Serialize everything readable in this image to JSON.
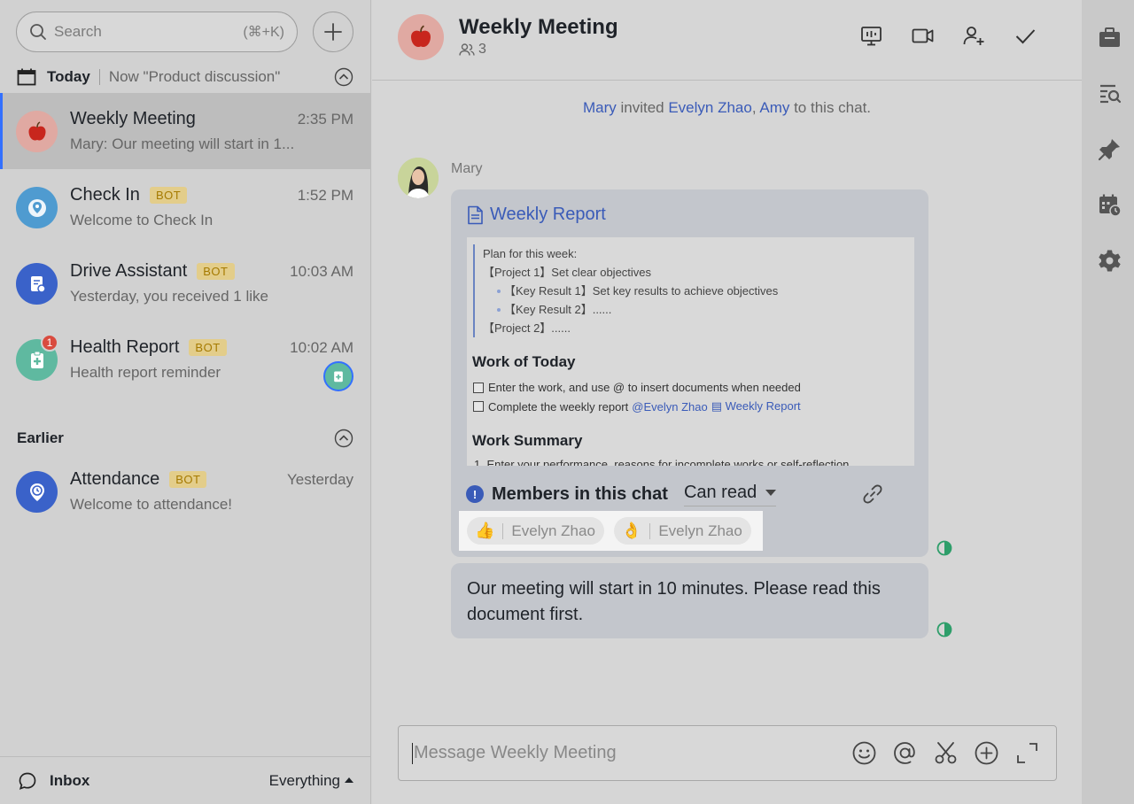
{
  "sidebar": {
    "search": {
      "placeholder": "Search",
      "shortcut": "(⌘+K)"
    },
    "today_section": {
      "title": "Today",
      "now_label": "Now \"Product discussion\""
    },
    "earlier_section": {
      "title": "Earlier"
    },
    "chats": [
      {
        "title": "Weekly Meeting",
        "time": "2:35 PM",
        "preview": "Mary: Our meeting will start in 1...",
        "active": true
      },
      {
        "title": "Check In",
        "bot": "BOT",
        "time": "1:52 PM",
        "preview": "Welcome to Check In"
      },
      {
        "title": "Drive Assistant",
        "bot": "BOT",
        "time": "10:03 AM",
        "preview": "Yesterday, you received 1 like"
      },
      {
        "title": "Health Report",
        "bot": "BOT",
        "time": "10:02 AM",
        "preview": "Health report reminder",
        "badge": "1"
      },
      {
        "title": "Attendance",
        "bot": "BOT",
        "time": "Yesterday",
        "preview": "Welcome to attendance!"
      }
    ],
    "bottom": {
      "inbox_label": "Inbox",
      "filter_label": "Everything"
    }
  },
  "header": {
    "title": "Weekly Meeting",
    "member_count": "3"
  },
  "system_message": {
    "inviter": "Mary",
    "text1": " invited ",
    "invitee1": "Evelyn Zhao",
    "comma": ", ",
    "invitee2": "Amy",
    "text2": " to this chat."
  },
  "message": {
    "sender": "Mary",
    "card": {
      "title": "Weekly Report",
      "preview": {
        "plan_label": "Plan for this week:",
        "project1": "【Project 1】Set clear objectives",
        "kr1": "【Key Result 1】Set key results to achieve objectives",
        "kr2": "【Key Result 2】......",
        "project2": "【Project 2】......",
        "heading_work_today": "Work of Today",
        "task1": "Enter the work, and use @ to insert documents when needed",
        "task2": "Complete the weekly report",
        "task2_mention": "@Evelyn Zhao",
        "task2_doc": "Weekly Report",
        "heading_summary": "Work Summary",
        "cut_line": "1.  Enter your performance, reasons for incomplete works or self-reflection"
      },
      "permission": {
        "label": "Members in this chat",
        "value": "Can read"
      },
      "reactions": [
        {
          "emoji": "👍",
          "who": "Evelyn Zhao"
        },
        {
          "emoji": "👌",
          "who": "Evelyn Zhao"
        }
      ]
    },
    "text": "Our meeting will start in 10 minutes. Please read this document first."
  },
  "composer": {
    "placeholder": "Message Weekly Meeting"
  },
  "colors": {
    "accent": "#3370ff",
    "link": "#3a5bb8",
    "bot_tag": "#e3cd8a",
    "badge": "#d94b3f"
  }
}
